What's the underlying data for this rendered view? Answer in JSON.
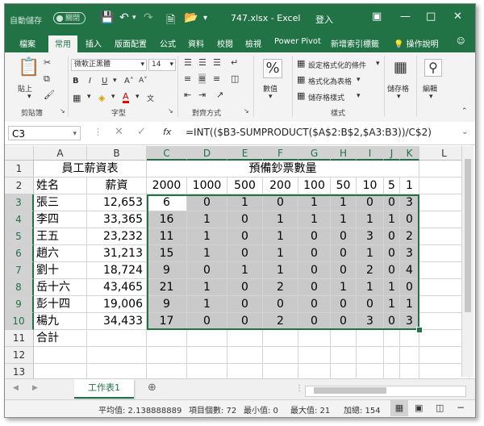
{
  "titlebar": {
    "autosave": "自動儲存",
    "toggle": "關閉",
    "filename": "747.xlsx  -  Excel",
    "login": "登入"
  },
  "tabs": [
    "檔案",
    "常用",
    "插入",
    "版面配置",
    "公式",
    "資料",
    "校閱",
    "檢視",
    "Power Pivot",
    "新增索引標籤",
    "操作說明"
  ],
  "active_tab": "常用",
  "ribbon": {
    "paste": "貼上",
    "clipboard": "剪貼簿",
    "font_name": "微軟正黑體",
    "font_size": "14",
    "font_group": "字型",
    "align_group": "對齊方式",
    "number_label": "數值",
    "cond_format": "設定格式化的條件",
    "table_format": "格式化為表格",
    "cell_styles": "儲存格樣式",
    "styles_group": "樣式",
    "cells_label": "儲存格",
    "editing_label": "編輯"
  },
  "formula_bar": {
    "cell_ref": "C3",
    "fx": "fx",
    "formula": "=INT(($B3-SUMPRODUCT($A$2:B$2,$A3:B3))/C$2)"
  },
  "columns": [
    "A",
    "B",
    "C",
    "D",
    "E",
    "F",
    "G",
    "H",
    "I",
    "J",
    "K",
    "L"
  ],
  "rows": [
    "1",
    "2",
    "3",
    "4",
    "5",
    "6",
    "7",
    "8",
    "9",
    "10",
    "11",
    "12",
    "13"
  ],
  "sheet": {
    "A1": "員工薪資表",
    "C1": "預備鈔票數量",
    "A2": "姓名",
    "B2": "薪資",
    "denoms": [
      "2000",
      "1000",
      "500",
      "200",
      "100",
      "50",
      "10",
      "5",
      "1"
    ],
    "employees": [
      {
        "name": "張三",
        "salary": "12,653",
        "counts": [
          "6",
          "0",
          "1",
          "0",
          "1",
          "1",
          "0",
          "0",
          "3"
        ]
      },
      {
        "name": "李四",
        "salary": "33,365",
        "counts": [
          "16",
          "1",
          "0",
          "1",
          "1",
          "1",
          "1",
          "1",
          "0"
        ]
      },
      {
        "name": "王五",
        "salary": "23,232",
        "counts": [
          "11",
          "1",
          "0",
          "1",
          "0",
          "0",
          "3",
          "0",
          "2"
        ]
      },
      {
        "name": "趙六",
        "salary": "31,213",
        "counts": [
          "15",
          "1",
          "0",
          "1",
          "0",
          "0",
          "1",
          "0",
          "3"
        ]
      },
      {
        "name": "劉十",
        "salary": "18,724",
        "counts": [
          "9",
          "0",
          "1",
          "1",
          "0",
          "0",
          "2",
          "0",
          "4"
        ]
      },
      {
        "name": "岳十六",
        "salary": "43,465",
        "counts": [
          "21",
          "1",
          "0",
          "2",
          "0",
          "1",
          "1",
          "1",
          "0"
        ]
      },
      {
        "name": "彭十四",
        "salary": "19,006",
        "counts": [
          "9",
          "1",
          "0",
          "0",
          "0",
          "0",
          "0",
          "1",
          "1"
        ]
      },
      {
        "name": "楊九",
        "salary": "34,433",
        "counts": [
          "17",
          "0",
          "0",
          "2",
          "0",
          "0",
          "3",
          "0",
          "3"
        ]
      }
    ],
    "A11": "合計"
  },
  "sheet_tab": "工作表1",
  "status": {
    "average": "平均值: 2.138888889",
    "count": "項目個數: 72",
    "min": "最小值: 0",
    "max": "最大值: 21",
    "sum": "加總: 154"
  }
}
